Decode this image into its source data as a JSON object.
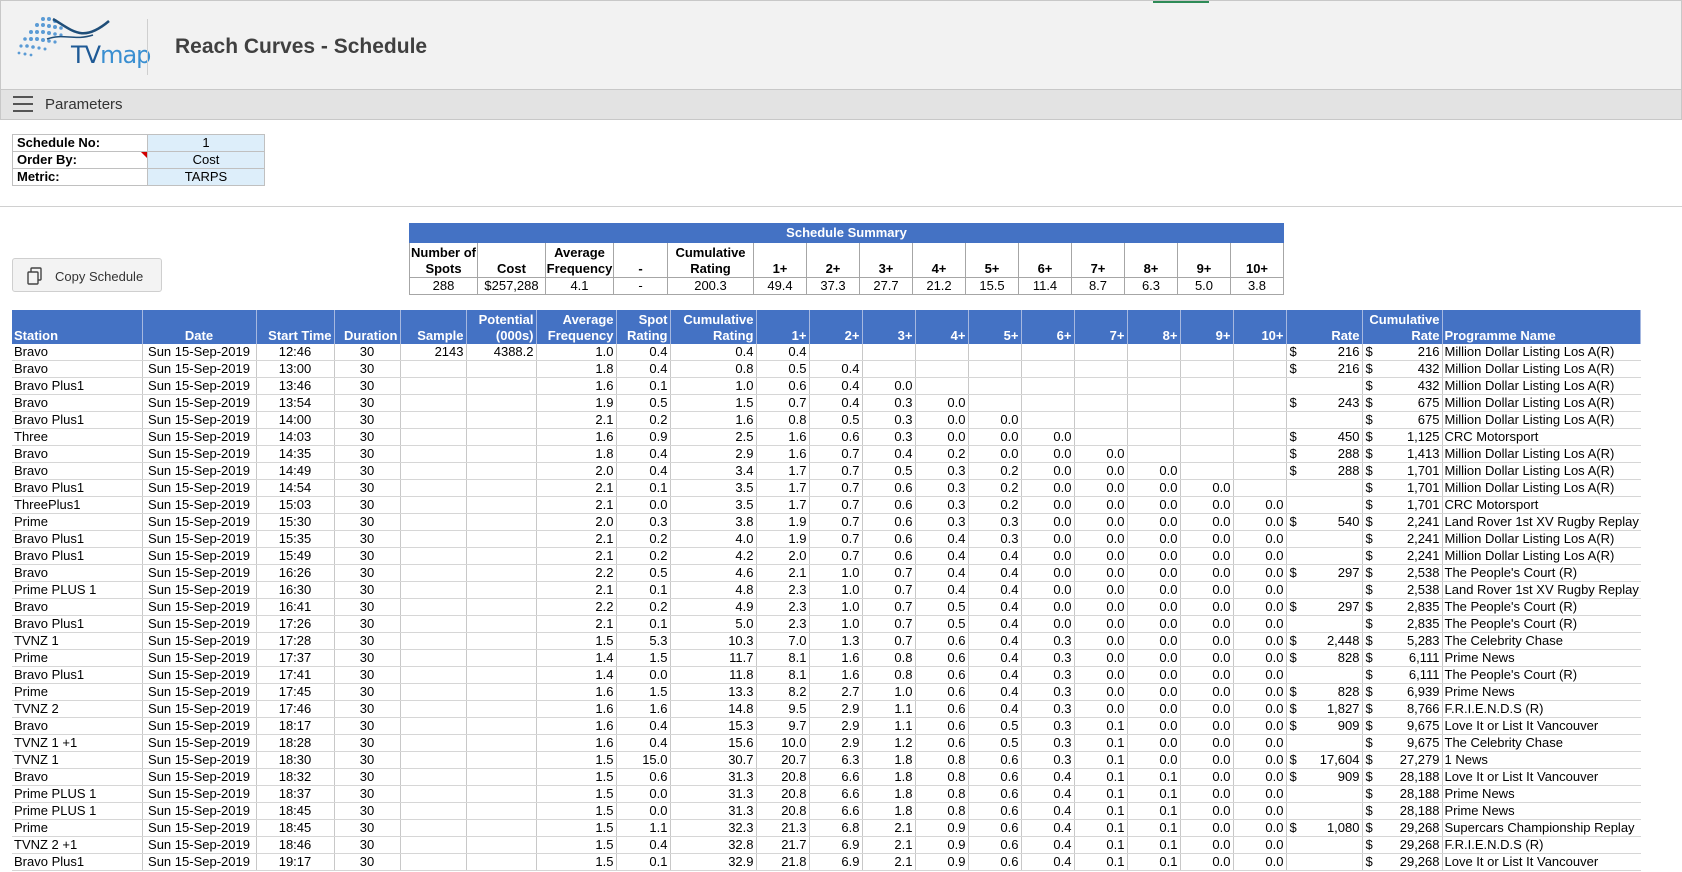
{
  "app": {
    "logo_text_main": "TV",
    "logo_text_accent": "map",
    "page_title": "Reach Curves - Schedule"
  },
  "parameters_bar": {
    "label": "Parameters"
  },
  "parameters": [
    {
      "label": "Schedule No:",
      "value": "1"
    },
    {
      "label": "Order By:",
      "value": "Cost"
    },
    {
      "label": "Metric:",
      "value": "TARPS"
    }
  ],
  "copy_button": {
    "label": "Copy Schedule"
  },
  "summary": {
    "title": "Schedule Summary",
    "headers": [
      "Number of Spots",
      "Cost",
      "Average Frequency",
      "-",
      "Cumulative Rating",
      "1+",
      "2+",
      "3+",
      "4+",
      "5+",
      "6+",
      "7+",
      "8+",
      "9+",
      "10+"
    ],
    "values": [
      "288",
      "$257,288",
      "4.1",
      "-",
      "200.3",
      "49.4",
      "37.3",
      "27.7",
      "21.2",
      "15.5",
      "11.4",
      "8.7",
      "6.3",
      "5.0",
      "3.8"
    ]
  },
  "table": {
    "headers": [
      "Station",
      "Date",
      "Start Time",
      "Duration",
      "Sample",
      "Potential (000s)",
      "Average Frequency",
      "Spot Rating",
      "Cumulative Rating",
      "1+",
      "2+",
      "3+",
      "4+",
      "5+",
      "6+",
      "7+",
      "8+",
      "9+",
      "10+",
      "Rate",
      "Cumulative Rate",
      "Programme Name"
    ],
    "currency_symbol": "$",
    "rows": [
      [
        "Bravo",
        "Sun 15-Sep-2019",
        "12:46",
        "30",
        "2143",
        "4388.2",
        "1.0",
        "0.4",
        "0.4",
        "0.4",
        "",
        "",
        "",
        "",
        "",
        "",
        "",
        "",
        "",
        "216",
        "216",
        "Million Dollar Listing Los A(R)"
      ],
      [
        "Bravo",
        "Sun 15-Sep-2019",
        "13:00",
        "30",
        "",
        "",
        "1.8",
        "0.4",
        "0.8",
        "0.5",
        "0.4",
        "",
        "",
        "",
        "",
        "",
        "",
        "",
        "",
        "216",
        "432",
        "Million Dollar Listing Los A(R)"
      ],
      [
        "Bravo Plus1",
        "Sun 15-Sep-2019",
        "13:46",
        "30",
        "",
        "",
        "1.6",
        "0.1",
        "1.0",
        "0.6",
        "0.4",
        "0.0",
        "",
        "",
        "",
        "",
        "",
        "",
        "",
        "",
        "432",
        "Million Dollar Listing Los A(R)"
      ],
      [
        "Bravo",
        "Sun 15-Sep-2019",
        "13:54",
        "30",
        "",
        "",
        "1.9",
        "0.5",
        "1.5",
        "0.7",
        "0.4",
        "0.3",
        "0.0",
        "",
        "",
        "",
        "",
        "",
        "",
        "243",
        "675",
        "Million Dollar Listing Los A(R)"
      ],
      [
        "Bravo Plus1",
        "Sun 15-Sep-2019",
        "14:00",
        "30",
        "",
        "",
        "2.1",
        "0.2",
        "1.6",
        "0.8",
        "0.5",
        "0.3",
        "0.0",
        "0.0",
        "",
        "",
        "",
        "",
        "",
        "",
        "675",
        "Million Dollar Listing Los A(R)"
      ],
      [
        "Three",
        "Sun 15-Sep-2019",
        "14:03",
        "30",
        "",
        "",
        "1.6",
        "0.9",
        "2.5",
        "1.6",
        "0.6",
        "0.3",
        "0.0",
        "0.0",
        "0.0",
        "",
        "",
        "",
        "",
        "450",
        "1,125",
        "CRC Motorsport"
      ],
      [
        "Bravo",
        "Sun 15-Sep-2019",
        "14:35",
        "30",
        "",
        "",
        "1.8",
        "0.4",
        "2.9",
        "1.6",
        "0.7",
        "0.4",
        "0.2",
        "0.0",
        "0.0",
        "0.0",
        "",
        "",
        "",
        "288",
        "1,413",
        "Million Dollar Listing Los A(R)"
      ],
      [
        "Bravo",
        "Sun 15-Sep-2019",
        "14:49",
        "30",
        "",
        "",
        "2.0",
        "0.4",
        "3.4",
        "1.7",
        "0.7",
        "0.5",
        "0.3",
        "0.2",
        "0.0",
        "0.0",
        "0.0",
        "",
        "",
        "288",
        "1,701",
        "Million Dollar Listing Los A(R)"
      ],
      [
        "Bravo Plus1",
        "Sun 15-Sep-2019",
        "14:54",
        "30",
        "",
        "",
        "2.1",
        "0.1",
        "3.5",
        "1.7",
        "0.7",
        "0.6",
        "0.3",
        "0.2",
        "0.0",
        "0.0",
        "0.0",
        "0.0",
        "",
        "",
        "1,701",
        "Million Dollar Listing Los A(R)"
      ],
      [
        "ThreePlus1",
        "Sun 15-Sep-2019",
        "15:03",
        "30",
        "",
        "",
        "2.1",
        "0.0",
        "3.5",
        "1.7",
        "0.7",
        "0.6",
        "0.3",
        "0.2",
        "0.0",
        "0.0",
        "0.0",
        "0.0",
        "0.0",
        "",
        "1,701",
        "CRC Motorsport"
      ],
      [
        "Prime",
        "Sun 15-Sep-2019",
        "15:30",
        "30",
        "",
        "",
        "2.0",
        "0.3",
        "3.8",
        "1.9",
        "0.7",
        "0.6",
        "0.3",
        "0.3",
        "0.0",
        "0.0",
        "0.0",
        "0.0",
        "0.0",
        "540",
        "2,241",
        "Land Rover 1st XV Rugby Replay"
      ],
      [
        "Bravo Plus1",
        "Sun 15-Sep-2019",
        "15:35",
        "30",
        "",
        "",
        "2.1",
        "0.2",
        "4.0",
        "1.9",
        "0.7",
        "0.6",
        "0.4",
        "0.3",
        "0.0",
        "0.0",
        "0.0",
        "0.0",
        "0.0",
        "",
        "2,241",
        "Million Dollar Listing Los A(R)"
      ],
      [
        "Bravo Plus1",
        "Sun 15-Sep-2019",
        "15:49",
        "30",
        "",
        "",
        "2.1",
        "0.2",
        "4.2",
        "2.0",
        "0.7",
        "0.6",
        "0.4",
        "0.4",
        "0.0",
        "0.0",
        "0.0",
        "0.0",
        "0.0",
        "",
        "2,241",
        "Million Dollar Listing Los A(R)"
      ],
      [
        "Bravo",
        "Sun 15-Sep-2019",
        "16:26",
        "30",
        "",
        "",
        "2.2",
        "0.5",
        "4.6",
        "2.1",
        "1.0",
        "0.7",
        "0.4",
        "0.4",
        "0.0",
        "0.0",
        "0.0",
        "0.0",
        "0.0",
        "297",
        "2,538",
        "The People's Court (R)"
      ],
      [
        "Prime PLUS 1",
        "Sun 15-Sep-2019",
        "16:30",
        "30",
        "",
        "",
        "2.1",
        "0.1",
        "4.8",
        "2.3",
        "1.0",
        "0.7",
        "0.4",
        "0.4",
        "0.0",
        "0.0",
        "0.0",
        "0.0",
        "0.0",
        "",
        "2,538",
        "Land Rover 1st XV Rugby Replay"
      ],
      [
        "Bravo",
        "Sun 15-Sep-2019",
        "16:41",
        "30",
        "",
        "",
        "2.2",
        "0.2",
        "4.9",
        "2.3",
        "1.0",
        "0.7",
        "0.5",
        "0.4",
        "0.0",
        "0.0",
        "0.0",
        "0.0",
        "0.0",
        "297",
        "2,835",
        "The People's Court (R)"
      ],
      [
        "Bravo Plus1",
        "Sun 15-Sep-2019",
        "17:26",
        "30",
        "",
        "",
        "2.1",
        "0.1",
        "5.0",
        "2.3",
        "1.0",
        "0.7",
        "0.5",
        "0.4",
        "0.0",
        "0.0",
        "0.0",
        "0.0",
        "0.0",
        "",
        "2,835",
        "The People's Court (R)"
      ],
      [
        "TVNZ 1",
        "Sun 15-Sep-2019",
        "17:28",
        "30",
        "",
        "",
        "1.5",
        "5.3",
        "10.3",
        "7.0",
        "1.3",
        "0.7",
        "0.6",
        "0.4",
        "0.3",
        "0.0",
        "0.0",
        "0.0",
        "0.0",
        "2,448",
        "5,283",
        "The Celebrity Chase"
      ],
      [
        "Prime",
        "Sun 15-Sep-2019",
        "17:37",
        "30",
        "",
        "",
        "1.4",
        "1.5",
        "11.7",
        "8.1",
        "1.6",
        "0.8",
        "0.6",
        "0.4",
        "0.3",
        "0.0",
        "0.0",
        "0.0",
        "0.0",
        "828",
        "6,111",
        "Prime News"
      ],
      [
        "Bravo Plus1",
        "Sun 15-Sep-2019",
        "17:41",
        "30",
        "",
        "",
        "1.4",
        "0.0",
        "11.8",
        "8.1",
        "1.6",
        "0.8",
        "0.6",
        "0.4",
        "0.3",
        "0.0",
        "0.0",
        "0.0",
        "0.0",
        "",
        "6,111",
        "The People's Court (R)"
      ],
      [
        "Prime",
        "Sun 15-Sep-2019",
        "17:45",
        "30",
        "",
        "",
        "1.6",
        "1.5",
        "13.3",
        "8.2",
        "2.7",
        "1.0",
        "0.6",
        "0.4",
        "0.3",
        "0.0",
        "0.0",
        "0.0",
        "0.0",
        "828",
        "6,939",
        "Prime News"
      ],
      [
        "TVNZ 2",
        "Sun 15-Sep-2019",
        "17:46",
        "30",
        "",
        "",
        "1.6",
        "1.6",
        "14.8",
        "9.5",
        "2.9",
        "1.1",
        "0.6",
        "0.4",
        "0.3",
        "0.0",
        "0.0",
        "0.0",
        "0.0",
        "1,827",
        "8,766",
        "F.R.I.E.N.D.S (R)"
      ],
      [
        "Bravo",
        "Sun 15-Sep-2019",
        "18:17",
        "30",
        "",
        "",
        "1.6",
        "0.4",
        "15.3",
        "9.7",
        "2.9",
        "1.1",
        "0.6",
        "0.5",
        "0.3",
        "0.1",
        "0.0",
        "0.0",
        "0.0",
        "909",
        "9,675",
        "Love It or List It Vancouver"
      ],
      [
        "TVNZ 1 +1",
        "Sun 15-Sep-2019",
        "18:28",
        "30",
        "",
        "",
        "1.6",
        "0.4",
        "15.6",
        "10.0",
        "2.9",
        "1.2",
        "0.6",
        "0.5",
        "0.3",
        "0.1",
        "0.0",
        "0.0",
        "0.0",
        "",
        "9,675",
        "The Celebrity Chase"
      ],
      [
        "TVNZ 1",
        "Sun 15-Sep-2019",
        "18:30",
        "30",
        "",
        "",
        "1.5",
        "15.0",
        "30.7",
        "20.7",
        "6.3",
        "1.8",
        "0.8",
        "0.6",
        "0.3",
        "0.1",
        "0.0",
        "0.0",
        "0.0",
        "17,604",
        "27,279",
        "1 News"
      ],
      [
        "Bravo",
        "Sun 15-Sep-2019",
        "18:32",
        "30",
        "",
        "",
        "1.5",
        "0.6",
        "31.3",
        "20.8",
        "6.6",
        "1.8",
        "0.8",
        "0.6",
        "0.4",
        "0.1",
        "0.1",
        "0.0",
        "0.0",
        "909",
        "28,188",
        "Love It or List It Vancouver"
      ],
      [
        "Prime PLUS 1",
        "Sun 15-Sep-2019",
        "18:37",
        "30",
        "",
        "",
        "1.5",
        "0.0",
        "31.3",
        "20.8",
        "6.6",
        "1.8",
        "0.8",
        "0.6",
        "0.4",
        "0.1",
        "0.1",
        "0.0",
        "0.0",
        "",
        "28,188",
        "Prime News"
      ],
      [
        "Prime PLUS 1",
        "Sun 15-Sep-2019",
        "18:45",
        "30",
        "",
        "",
        "1.5",
        "0.0",
        "31.3",
        "20.8",
        "6.6",
        "1.8",
        "0.8",
        "0.6",
        "0.4",
        "0.1",
        "0.1",
        "0.0",
        "0.0",
        "",
        "28,188",
        "Prime News"
      ],
      [
        "Prime",
        "Sun 15-Sep-2019",
        "18:45",
        "30",
        "",
        "",
        "1.5",
        "1.1",
        "32.3",
        "21.3",
        "6.8",
        "2.1",
        "0.9",
        "0.6",
        "0.4",
        "0.1",
        "0.1",
        "0.0",
        "0.0",
        "1,080",
        "29,268",
        "Supercars Championship Replay"
      ],
      [
        "TVNZ 2 +1",
        "Sun 15-Sep-2019",
        "18:46",
        "30",
        "",
        "",
        "1.5",
        "0.4",
        "32.8",
        "21.7",
        "6.9",
        "2.1",
        "0.9",
        "0.6",
        "0.4",
        "0.1",
        "0.1",
        "0.0",
        "0.0",
        "",
        "29,268",
        "F.R.I.E.N.D.S (R)"
      ],
      [
        "Bravo Plus1",
        "Sun 15-Sep-2019",
        "19:17",
        "30",
        "",
        "",
        "1.5",
        "0.1",
        "32.9",
        "21.8",
        "6.9",
        "2.1",
        "0.9",
        "0.6",
        "0.4",
        "0.1",
        "0.1",
        "0.0",
        "0.0",
        "",
        "29,268",
        "Love It or List It Vancouver"
      ]
    ]
  }
}
